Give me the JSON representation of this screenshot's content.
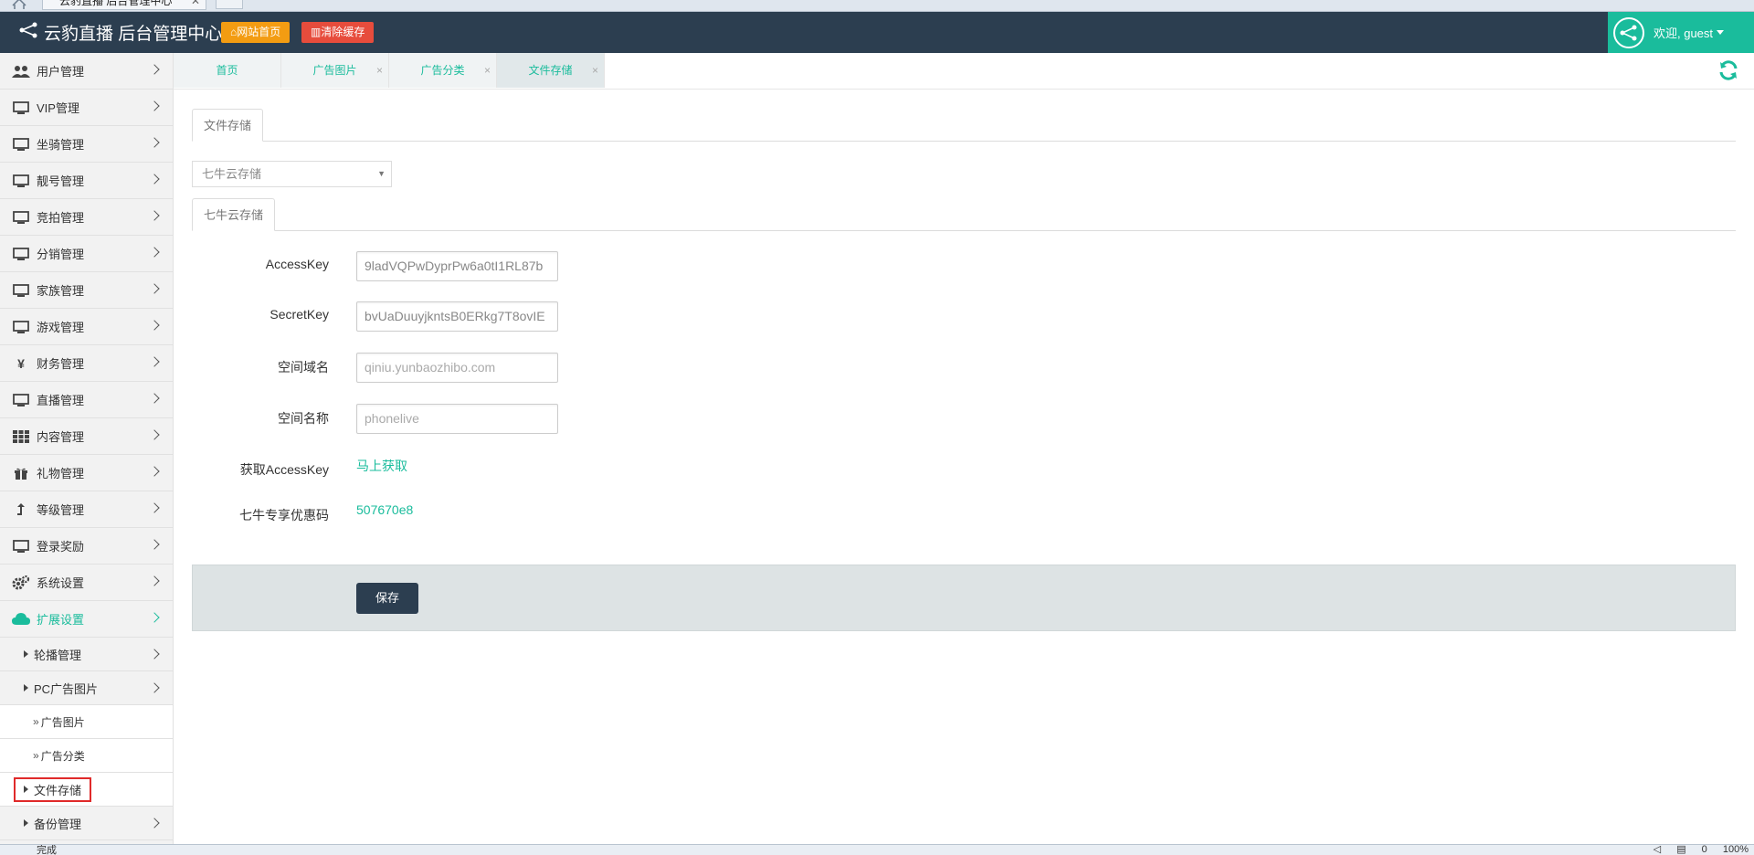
{
  "browser": {
    "tab_title": "云豹直播 后台管理中心",
    "status_text": "完成",
    "zoom": "100%",
    "status_count": "0"
  },
  "header": {
    "brand_title": "云豹直播 后台管理中心",
    "site_home_label": "网站首页",
    "clear_cache_label": "清除缓存",
    "welcome_text": "欢迎, guest",
    "colors": {
      "bar": "#2c3e50",
      "accent": "#1abc9c",
      "orange": "#f39c12",
      "red": "#e74c3c"
    }
  },
  "sidebar": {
    "items": [
      {
        "label": "用户管理",
        "icon": "users-icon"
      },
      {
        "label": "VIP管理",
        "icon": "monitor-icon"
      },
      {
        "label": "坐骑管理",
        "icon": "monitor-icon"
      },
      {
        "label": "靓号管理",
        "icon": "monitor-icon"
      },
      {
        "label": "竞拍管理",
        "icon": "monitor-icon"
      },
      {
        "label": "分销管理",
        "icon": "monitor-icon"
      },
      {
        "label": "家族管理",
        "icon": "monitor-icon"
      },
      {
        "label": "游戏管理",
        "icon": "monitor-icon"
      },
      {
        "label": "财务管理",
        "icon": "yen-icon"
      },
      {
        "label": "直播管理",
        "icon": "monitor-icon"
      },
      {
        "label": "内容管理",
        "icon": "grid-icon"
      },
      {
        "label": "礼物管理",
        "icon": "gift-icon"
      },
      {
        "label": "等级管理",
        "icon": "level-up-icon"
      },
      {
        "label": "登录奖励",
        "icon": "monitor-icon"
      },
      {
        "label": "系统设置",
        "icon": "gears-icon"
      },
      {
        "label": "扩展设置",
        "icon": "cloud-icon"
      }
    ],
    "sub_items": [
      {
        "label": "轮播管理"
      },
      {
        "label": "PC广告图片"
      }
    ],
    "sub2_items": [
      {
        "label": "广告图片"
      },
      {
        "label": "广告分类"
      }
    ],
    "file_storage_label": "文件存储",
    "backup_label": "备份管理"
  },
  "tabs": [
    {
      "label": "首页"
    },
    {
      "label": "广告图片"
    },
    {
      "label": "广告分类"
    },
    {
      "label": "文件存储"
    }
  ],
  "content": {
    "outer_tab": "文件存储",
    "select_value": "七牛云存储",
    "inner_tab": "七牛云存储",
    "fields": {
      "access_key": {
        "label": "AccessKey",
        "value": "9ladVQPwDyprPw6a0tI1RL87b"
      },
      "secret_key": {
        "label": "SecretKey",
        "value": "bvUaDuuyjkntsB0ERkg7T8ovIE"
      },
      "domain": {
        "label": "空间域名",
        "placeholder": "qiniu.yunbaozhibo.com"
      },
      "bucket": {
        "label": "空间名称",
        "placeholder": "phonelive"
      }
    },
    "get_key": {
      "label": "获取AccessKey",
      "link": "马上获取"
    },
    "promo": {
      "label": "七牛专享优惠码",
      "value": "507670e8"
    },
    "save_label": "保存"
  }
}
